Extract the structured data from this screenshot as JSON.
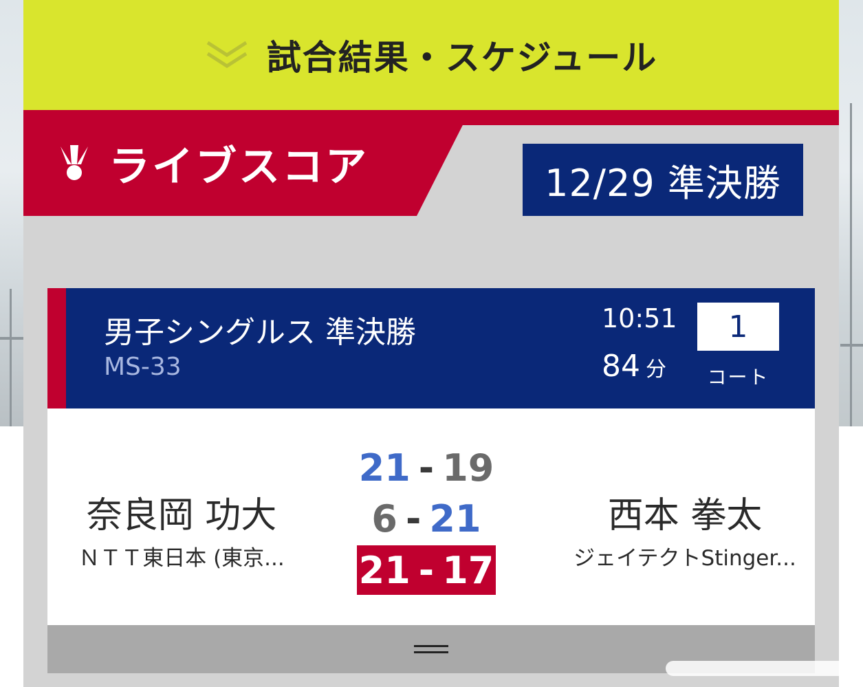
{
  "header": {
    "title": "試合結果・スケジュール",
    "chevron_icon": "double-chevron-down-icon"
  },
  "live": {
    "title": "ライブスコア",
    "icon": "shuttlecock-icon",
    "date_round": "12/29 準決勝"
  },
  "match": {
    "event": "男子シングルス 準決勝",
    "code": "MS-33",
    "start_time": "10:51",
    "duration_value": "84",
    "duration_unit": "分",
    "court_number": "1",
    "court_label": "コート",
    "player_left": {
      "name": "奈良岡 功大",
      "team": "ＮＴＴ東日本 (東京..."
    },
    "player_right": {
      "name": "西本 拳太",
      "team": "ジェイテクトStinger..."
    },
    "games": [
      {
        "left": "21",
        "right": "19",
        "winner": "left"
      },
      {
        "left": "6",
        "right": "21",
        "winner": "right"
      },
      {
        "left": "21",
        "right": "17",
        "winner": "left",
        "final": true
      }
    ],
    "menu_icon": "hamburger-icon"
  },
  "colors": {
    "header_yellow": "#d9e52d",
    "brand_red": "#c0002f",
    "navy": "#0a2878",
    "score_blue": "#3f6ac8"
  }
}
